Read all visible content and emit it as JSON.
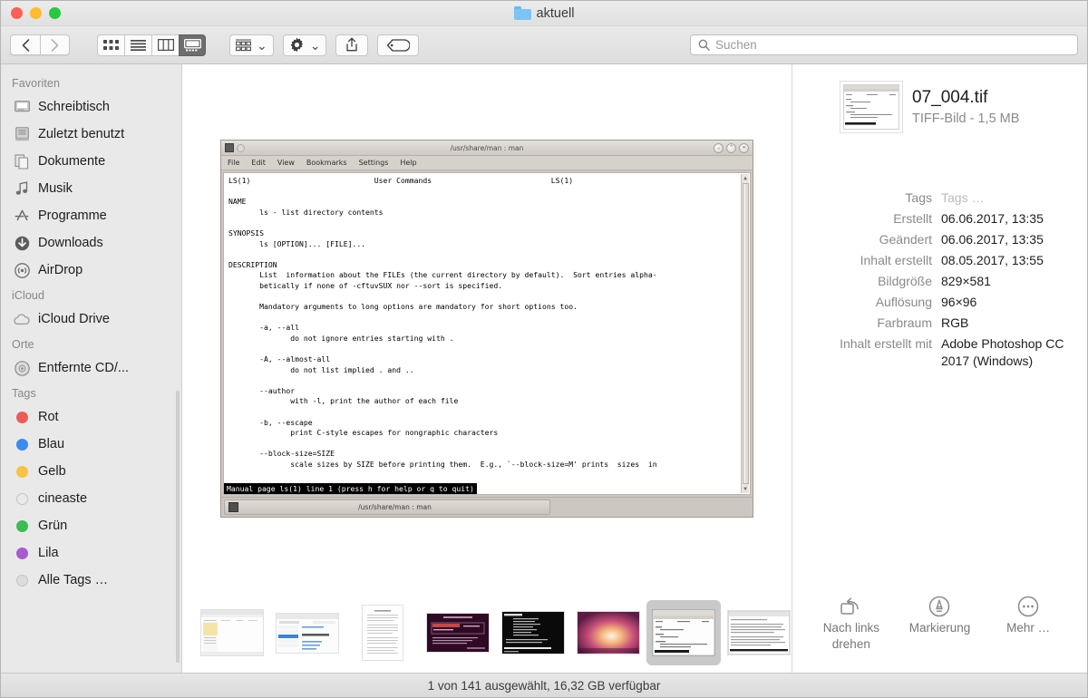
{
  "window": {
    "title": "aktuell",
    "traffic_lights": [
      "close",
      "minimize",
      "zoom"
    ]
  },
  "toolbar": {
    "back_label": "‹",
    "forward_label": "›",
    "view_modes": [
      {
        "name": "icon-view",
        "selected": false
      },
      {
        "name": "list-view",
        "selected": false
      },
      {
        "name": "column-view",
        "selected": false
      },
      {
        "name": "gallery-view",
        "selected": true
      }
    ],
    "arrange_label": "arrange-icon",
    "action_label": "gear-icon",
    "share_label": "share-icon",
    "tags_label": "tag-icon",
    "search_placeholder": "Suchen",
    "search_value": ""
  },
  "sidebar": {
    "sections": [
      {
        "heading": "Favoriten",
        "items": [
          {
            "label": "Schreibtisch",
            "icon": "desktop-icon"
          },
          {
            "label": "Zuletzt benutzt",
            "icon": "recents-icon"
          },
          {
            "label": "Dokumente",
            "icon": "documents-icon"
          },
          {
            "label": "Musik",
            "icon": "music-icon"
          },
          {
            "label": "Programme",
            "icon": "applications-icon"
          },
          {
            "label": "Downloads",
            "icon": "downloads-icon"
          },
          {
            "label": "AirDrop",
            "icon": "airdrop-icon"
          }
        ]
      },
      {
        "heading": "iCloud",
        "items": [
          {
            "label": "iCloud Drive",
            "icon": "cloud-icon"
          }
        ]
      },
      {
        "heading": "Orte",
        "items": [
          {
            "label": "Entfernte CD/...",
            "icon": "disc-icon"
          }
        ]
      },
      {
        "heading": "Tags",
        "items": [
          {
            "label": "Rot",
            "icon": "tag-dot",
            "color": "#ec5b56"
          },
          {
            "label": "Blau",
            "icon": "tag-dot",
            "color": "#3b8af0"
          },
          {
            "label": "Gelb",
            "icon": "tag-dot",
            "color": "#f6c344"
          },
          {
            "label": "cineaste",
            "icon": "tag-dot",
            "color": "#e3e3e3"
          },
          {
            "label": "Grün",
            "icon": "tag-dot",
            "color": "#3bbd54"
          },
          {
            "label": "Lila",
            "icon": "tag-dot",
            "color": "#a85bd1"
          },
          {
            "label": "Alle Tags …",
            "icon": "tag-dot",
            "color": "#d8d8d8"
          }
        ]
      }
    ]
  },
  "preview": {
    "window_title": "/usr/share/man : man",
    "menus": [
      "File",
      "Edit",
      "View",
      "Bookmarks",
      "Settings",
      "Help"
    ],
    "man_header_left": "LS(1)",
    "man_header_center": "User Commands",
    "man_header_right": "LS(1)",
    "man_text": "LS(1)                            User Commands                           LS(1)\n\nNAME\n       ls - list directory contents\n\nSYNOPSIS\n       ls [OPTION]... [FILE]...\n\nDESCRIPTION\n       List  information about the FILEs (the current directory by default).  Sort entries alpha-\n       betically if none of -cftuvSUX nor --sort is specified.\n\n       Mandatory arguments to long options are mandatory for short options too.\n\n       -a, --all\n              do not ignore entries starting with .\n\n       -A, --almost-all\n              do not list implied . and ..\n\n       --author\n              with -l, print the author of each file\n\n       -b, --escape\n              print C-style escapes for nongraphic characters\n\n       --block-size=SIZE\n              scale sizes by SIZE before printing them.  E.g., `--block-size=M' prints  sizes  in",
    "status_line": "Manual page ls(1) line 1 (press h for help or q to quit)",
    "taskbar_item": "/usr/share/man : man"
  },
  "filmstrip": {
    "items": [
      {
        "name": "thumb-file-manager",
        "selected": false
      },
      {
        "name": "thumb-settings-dialog",
        "selected": false
      },
      {
        "name": "thumb-text-document",
        "selected": false
      },
      {
        "name": "thumb-terminal-purple",
        "selected": false
      },
      {
        "name": "thumb-terminal-black",
        "selected": false
      },
      {
        "name": "thumb-ubuntu-wallpaper",
        "selected": false
      },
      {
        "name": "thumb-man-page",
        "selected": true
      },
      {
        "name": "thumb-text-window",
        "selected": false
      }
    ]
  },
  "info": {
    "file_name": "07_004.tif",
    "file_kind": "TIFF-Bild - 1,5 MB",
    "metadata": [
      {
        "key": "Tags",
        "value": "Tags …",
        "dim": true
      },
      {
        "key": "Erstellt",
        "value": "06.06.2017, 13:35",
        "dim": false
      },
      {
        "key": "Geändert",
        "value": "06.06.2017, 13:35",
        "dim": false
      },
      {
        "key": "Inhalt erstellt",
        "value": "08.05.2017, 13:55",
        "dim": false
      },
      {
        "key": "Bildgröße",
        "value": "829×581",
        "dim": false
      },
      {
        "key": "Auflösung",
        "value": "96×96",
        "dim": false
      },
      {
        "key": "Farbraum",
        "value": "RGB",
        "dim": false
      },
      {
        "key": "Inhalt erstellt mit",
        "value": "Adobe Photoshop CC 2017 (Windows)",
        "dim": false
      }
    ],
    "actions": [
      {
        "label": "Nach links drehen",
        "icon": "rotate-left-icon"
      },
      {
        "label": "Markierung",
        "icon": "markup-icon"
      },
      {
        "label": "Mehr …",
        "icon": "more-icon"
      }
    ]
  },
  "statusbar": {
    "text": "1 von 141 ausgewählt, 16,32 GB verfügbar"
  }
}
